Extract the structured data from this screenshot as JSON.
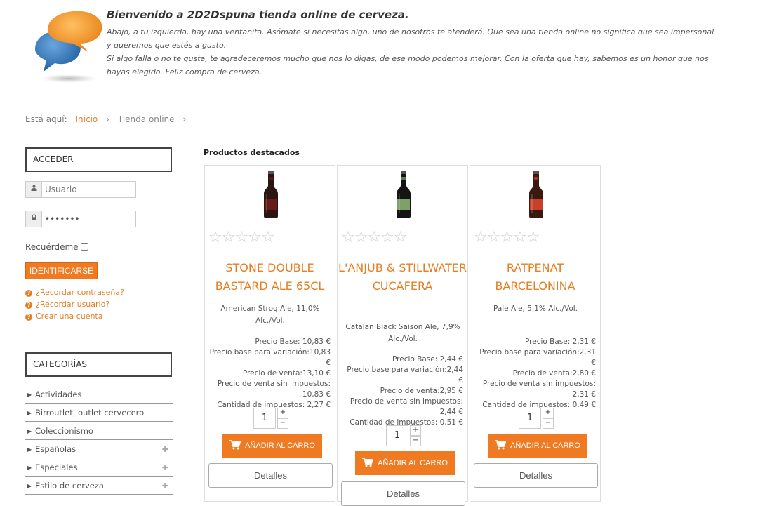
{
  "welcome": {
    "title": "Bienvenido a 2D2Dspuna tienda online de cerveza.",
    "paragraph1": "Abajo, a tu izquierda, hay una ventanita. Asómate si necesitas algo, uno de nosotros te atenderá. Que sea una tienda online no significa que sea impersonal y queremos que estés a gusto.",
    "paragraph2": "Si algo falla o no te gusta, te agradeceremos mucho que nos lo digas, de ese modo podemos mejorar. Con la oferta que hay, sabemos es un honor que nos hayas elegido. Feliz compra de cerveza."
  },
  "breadcrumb": {
    "prefix": "Está aquí:",
    "items": [
      "Inicio",
      "Tienda online"
    ]
  },
  "login": {
    "title": "ACCEDER",
    "username_placeholder": "Usuario",
    "password_value": "•••••••",
    "remember_label": "Recuérdeme",
    "submit_label": "IDENTIFICARSE",
    "links": [
      "¿Recordar contraseña?",
      "¿Recordar usuario?",
      "Crear una cuenta"
    ]
  },
  "categories": {
    "title": "CATEGORÍAS",
    "items": [
      {
        "label": "Actividades",
        "expandable": false
      },
      {
        "label": "Birroutlet, outlet cervecero",
        "expandable": false
      },
      {
        "label": "Coleccionismo",
        "expandable": false
      },
      {
        "label": "Españolas",
        "expandable": true
      },
      {
        "label": "Especiales",
        "expandable": true
      },
      {
        "label": "Estilo de cerveza",
        "expandable": true
      }
    ]
  },
  "products": {
    "heading": "Productos destacados",
    "add_to_cart_label": "AÑADIR AL CARRO",
    "details_label": "Detalles",
    "items": [
      {
        "name": "STONE DOUBLE BASTARD ALE 65CL",
        "description": "American Strog Ale, 11,0% Alc./Vol.",
        "price_lines": [
          "Precio Base: 10,83 €",
          "Precio base para variación:10,83 €",
          "Precio de venta:13,10 €",
          "Precio de venta sin impuestos:",
          "10,83 €",
          "Cantidad de impuestos: 2,27 €"
        ],
        "quantity": "1",
        "rating": 0,
        "bottle_color": "#2a1512",
        "label_color": "#6b1a1a"
      },
      {
        "name": "L'ANJUB & STILLWATER CUCAFERA",
        "description": "Catalan Black Saison Ale, 7,9% Alc./Vol.",
        "price_lines": [
          "Precio Base: 2,44 €",
          "Precio base para variación:2,44 €",
          "Precio de venta:2,95 €",
          "Precio de venta sin impuestos:",
          "2,44 €",
          "Cantidad de impuestos: 0,51 €"
        ],
        "quantity": "1",
        "rating": 0,
        "bottle_color": "#141414",
        "label_color": "#7fa06a"
      },
      {
        "name": "RATPENAT BARCELONINA",
        "description": "Pale Ale, 5,1% Alc./Vol.",
        "price_lines": [
          "Precio Base: 2,31 €",
          "Precio base para variación:2,31 €",
          "Precio de venta:2,80 €",
          "Precio de venta sin impuestos:",
          "2,31 €",
          "Cantidad de impuestos: 0,49 €"
        ],
        "quantity": "1",
        "rating": 0,
        "bottle_color": "#3a1a10",
        "label_color": "#c9402a"
      }
    ]
  },
  "colors": {
    "accent": "#f07a22",
    "link": "#e67e22"
  }
}
